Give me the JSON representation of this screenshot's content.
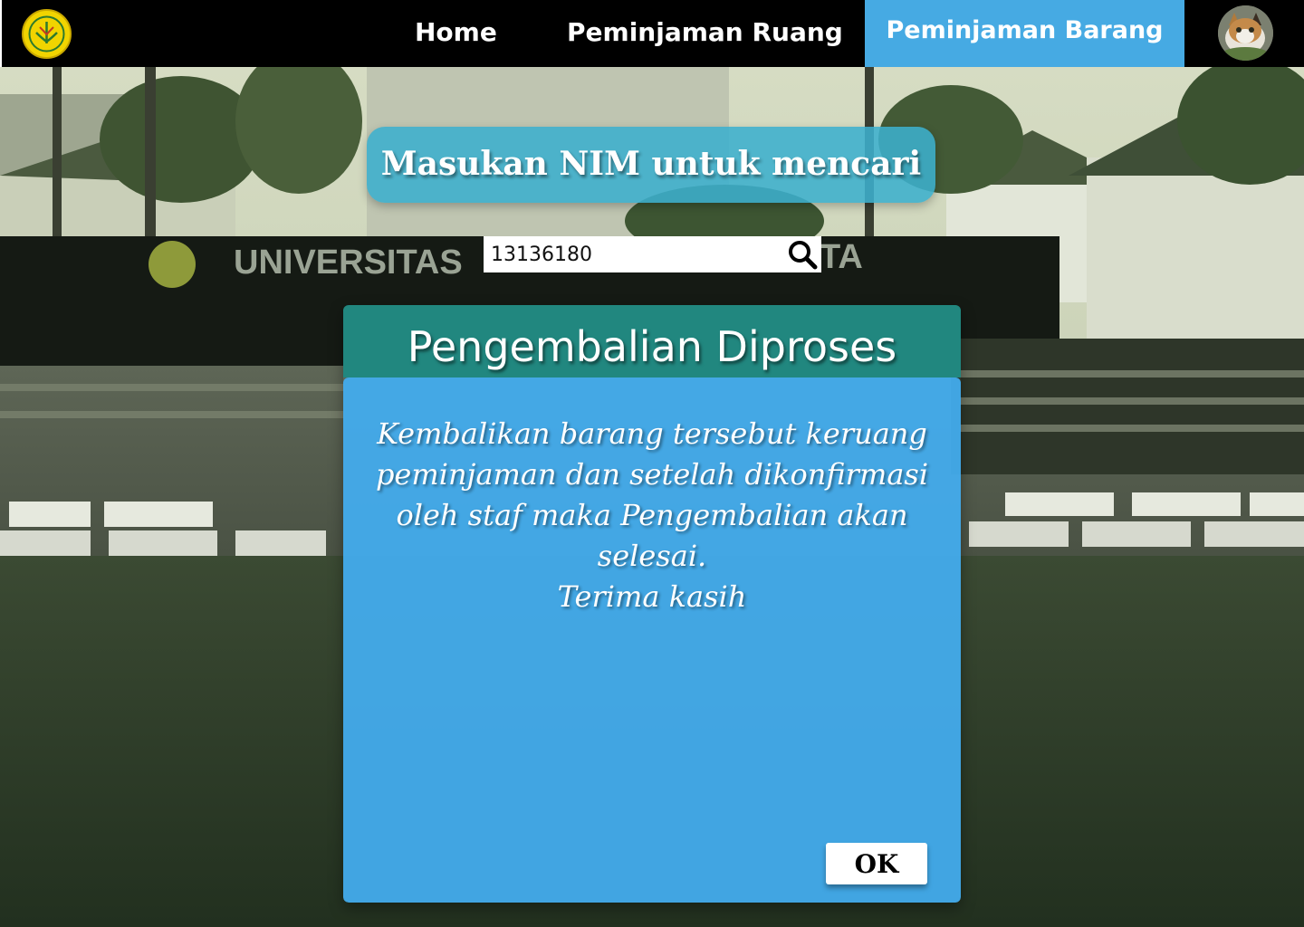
{
  "navbar": {
    "logo_icon": "university-logo-icon",
    "items": [
      {
        "label": "Home",
        "active": false
      },
      {
        "label": "Peminjaman Ruang",
        "active": false
      },
      {
        "label": "Peminjaman Barang",
        "active": true
      }
    ],
    "avatar_icon": "user-avatar-cat-photo",
    "active_color": "#46aae3",
    "background_color": "#000000"
  },
  "background": {
    "sign_text_left": "UNIVERSITAS",
    "sign_text_right": "TA"
  },
  "search": {
    "heading": "Masukan NIM untuk mencari",
    "value": "13136180",
    "icon": "search-icon"
  },
  "modal": {
    "title": "Pengembalian Diproses",
    "message_lines": [
      "Kembalikan barang tersebut keruang",
      "peminjaman dan setelah dikonfirmasi",
      "oleh staf maka Pengembalian akan",
      "selesai.",
      "Terima kasih"
    ],
    "ok_label": "OK",
    "header_color": "#21877f",
    "body_color": "#43acee"
  }
}
